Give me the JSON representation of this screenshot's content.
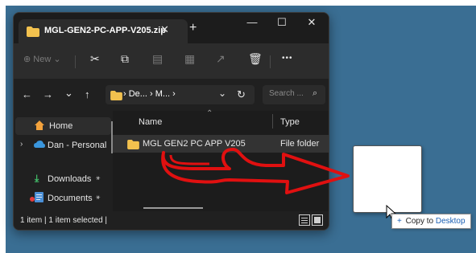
{
  "window": {
    "tab_title": "MGL-GEN2-PC-APP-V205.zip",
    "tab_close": "✕",
    "new_tab": "+",
    "minimize": "—",
    "maximize": "☐",
    "close": "✕"
  },
  "toolbar": {
    "new_label": "New",
    "more_label": "•••"
  },
  "address_bar": {
    "back": "←",
    "forward": "→",
    "history": "⌄",
    "up": "↑",
    "breadcrumb": "› De... › M... ›",
    "dropdown": "⌄",
    "refresh": "↻",
    "search_placeholder": "Search ...",
    "search_icon": "⌕"
  },
  "sidebar": {
    "items": [
      {
        "label": "Home",
        "icon": "home-icon"
      },
      {
        "label": "Dan - Personal",
        "icon": "cloud-icon"
      },
      {
        "label": "Downloads",
        "icon": "download-icon"
      },
      {
        "label": "Documents",
        "icon": "documents-icon"
      }
    ],
    "pin": "📌"
  },
  "content": {
    "columns": [
      "Name",
      "Type"
    ],
    "rows": [
      {
        "name": "MGL GEN2 PC APP V205",
        "type": "File folder"
      }
    ]
  },
  "status": {
    "text": "1 item  |  1 item selected  |"
  },
  "drag": {
    "tooltip_plus": "+",
    "tooltip_action": "Copy to",
    "tooltip_destination": "Desktop"
  },
  "colors": {
    "desktop": "#3a6e93",
    "folder": "#f2c14e",
    "annotation_arrow": "#e01010"
  }
}
